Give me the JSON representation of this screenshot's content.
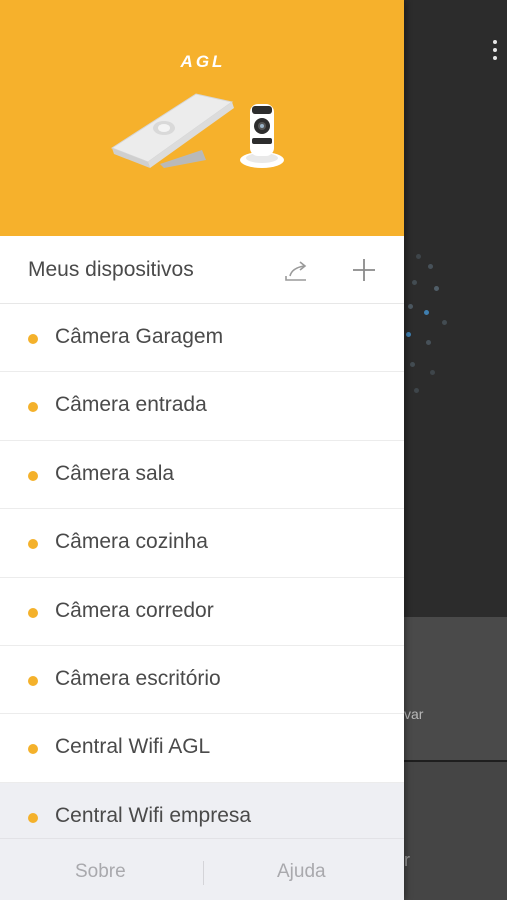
{
  "brand": {
    "logo_text": "AGL",
    "header_color": "#F6B12C",
    "status_dot_color": "#F4B12B"
  },
  "devices": {
    "title": "Meus dispositivos",
    "share_icon": "share-icon",
    "add_icon": "plus-icon",
    "items": [
      {
        "label": "Câmera Garagem"
      },
      {
        "label": "Câmera entrada"
      },
      {
        "label": "Câmera sala"
      },
      {
        "label": "Câmera cozinha"
      },
      {
        "label": "Câmera corredor"
      },
      {
        "label": "Câmera escritório"
      },
      {
        "label": "Central Wifi AGL"
      },
      {
        "label": "Central Wifi empresa",
        "selected": true
      }
    ]
  },
  "footer": {
    "about_label": "Sobre",
    "help_label": "Ajuda"
  },
  "background": {
    "partial_text": "var",
    "partial_glyph": "r"
  }
}
